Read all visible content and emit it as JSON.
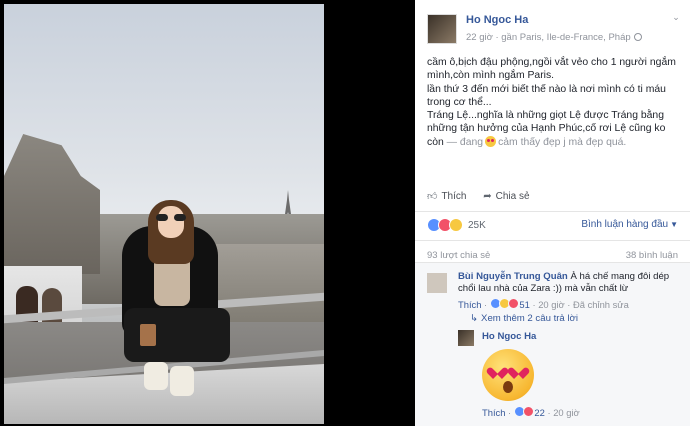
{
  "post": {
    "author": "Ho Ngoc Ha",
    "meta": "22 giờ · gần Paris, Ile-de-France, Pháp",
    "text_line1": "cầm ô,bịch đậu phộng,ngồi vắt vẻo cho 1 người ngắm mình,còn mình ngắm Paris.",
    "text_line2": "lần thứ 3 đến mới biết thế nào là nơi mình có ti máu trong cơ thể...",
    "text_line3": "Tráng Lệ...nghĩa là những giọt Lệ được Tráng bằng những tận hưởng của Hạnh Phúc,cố rơi Lệ cũng ko còn",
    "feeling_prefix": "— đang",
    "feeling": "cảm thấy đẹp j mà đẹp quá."
  },
  "actions": {
    "like": "Thích",
    "share": "Chia sẻ"
  },
  "reactions": {
    "count": "25K",
    "top_comments": "Bình luận hàng đầu"
  },
  "stats": {
    "shares": "93 lượt chia sẻ",
    "comments": "38 bình luận"
  },
  "comment1": {
    "author": "Bùi Nguyễn Trung Quân",
    "text": "À há chế mang đôi dép chổi lau nhà của Zara :)) mà vẫn chất lừ",
    "like": "Thích",
    "reaction_count": "51",
    "time": "20 giờ",
    "edited": "Đã chỉnh sửa",
    "more_replies": "Xem thêm 2 câu trả lời"
  },
  "reply": {
    "author": "Ho Ngoc Ha",
    "like": "Thích",
    "reaction_count": "22",
    "time": "20 giờ"
  },
  "colors": {
    "link": "#365899",
    "meta": "#90949c",
    "like_reaction": "#5890ff",
    "love_reaction": "#f25268",
    "haha_reaction": "#f7c840"
  }
}
